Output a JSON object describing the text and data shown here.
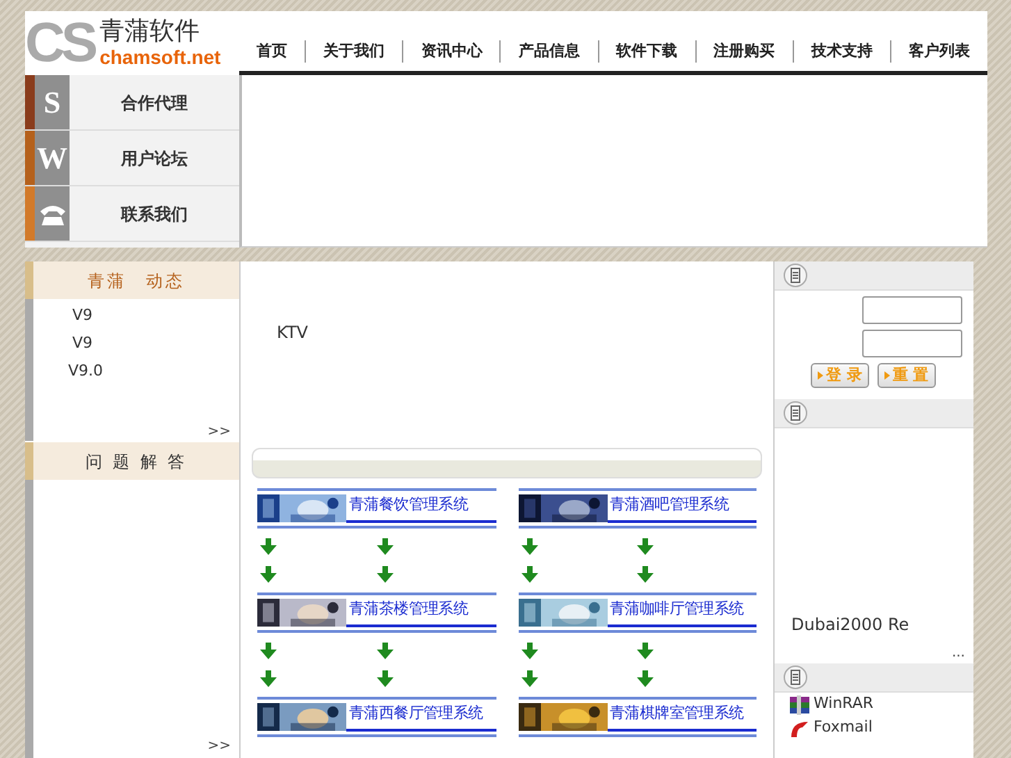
{
  "logo": {
    "mark": "CS",
    "name": "青蒲软件",
    "domain": "chamsoft.net"
  },
  "nav": [
    {
      "label": "首页"
    },
    {
      "label": "关于我们"
    },
    {
      "label": "资讯中心"
    },
    {
      "label": "产品信息"
    },
    {
      "label": "软件下载"
    },
    {
      "label": "注册购买"
    },
    {
      "label": "技术支持"
    },
    {
      "label": "客户列表"
    }
  ],
  "side_menu": [
    {
      "label": "合作代理",
      "kind": "letter",
      "letter": "S",
      "color": "#8a3c1c"
    },
    {
      "label": "用户论坛",
      "kind": "letter",
      "letter": "W",
      "color": "#b5611c"
    },
    {
      "label": "联系我们",
      "kind": "phone",
      "color": "#d27a2a"
    }
  ],
  "news": {
    "title": "青蒲　动态",
    "items": [
      "V9",
      "V9",
      "V9.0"
    ],
    "more": ">>"
  },
  "faq": {
    "title": "问 题 解 答",
    "more": ">>"
  },
  "intro": "KTV",
  "products": [
    {
      "title": "青蒲餐饮管理系统",
      "kind": "full"
    },
    {
      "title": "青蒲酒吧管理系统",
      "kind": "full"
    },
    {
      "title": "青蒲茶楼管理系统",
      "kind": "full"
    },
    {
      "title": "青蒲咖啡厅管理系统",
      "kind": "full"
    },
    {
      "title": "青蒲西餐厅管理系统",
      "kind": "header"
    },
    {
      "title": "青蒲棋牌室管理系统",
      "kind": "header"
    }
  ],
  "login": {
    "buttons": [
      "登 录",
      "重 置"
    ]
  },
  "right_news": {
    "items": [
      "Dubai2000 Re"
    ],
    "more": "..."
  },
  "downloads": [
    {
      "label": "WinRAR",
      "kind": "archive"
    },
    {
      "label": "Foxmail",
      "kind": "mail"
    }
  ]
}
